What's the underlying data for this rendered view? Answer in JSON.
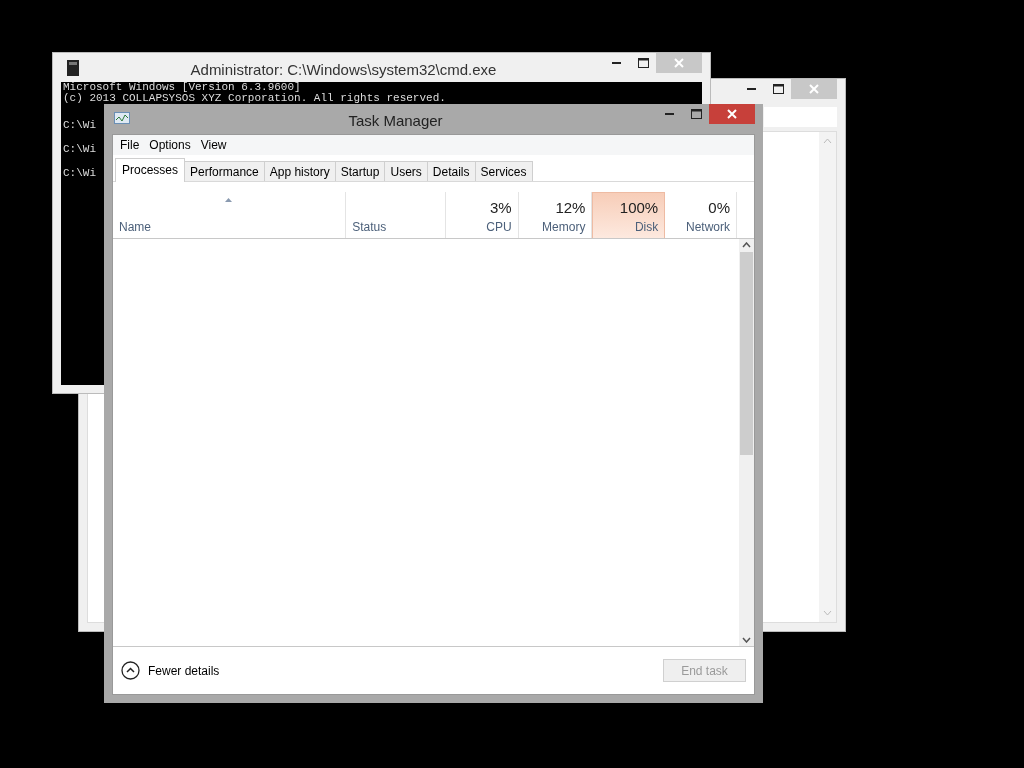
{
  "cmd_window": {
    "title": "Administrator: C:\\Windows\\system32\\cmd.exe",
    "lines": [
      "Microsoft Windows [Version 6.3.9600]",
      "(c) 2013 COLLAPSYSOS XYZ Corporation. All rights reserved.",
      "C:\\Wi",
      "C:\\Wi",
      "C:\\Wi"
    ]
  },
  "task_manager": {
    "title": "Task Manager",
    "menu": [
      "File",
      "Options",
      "View"
    ],
    "tabs": [
      {
        "label": "Processes",
        "selected": true
      },
      {
        "label": "Performance",
        "selected": false
      },
      {
        "label": "App history",
        "selected": false
      },
      {
        "label": "Startup",
        "selected": false
      },
      {
        "label": "Users",
        "selected": false
      },
      {
        "label": "Details",
        "selected": false
      },
      {
        "label": "Services",
        "selected": false
      }
    ],
    "columns": [
      {
        "heading": "Name",
        "sorted": true,
        "highlighted": false
      },
      {
        "heading": "Status",
        "sorted": false,
        "highlighted": false
      },
      {
        "value": "3%",
        "heading": "CPU",
        "sorted": false,
        "highlighted": false
      },
      {
        "value": "12%",
        "heading": "Memory",
        "sorted": false,
        "highlighted": false
      },
      {
        "value": "100%",
        "heading": "Disk",
        "sorted": false,
        "highlighted": true
      },
      {
        "value": "0%",
        "heading": "Network",
        "sorted": false,
        "highlighted": false
      }
    ],
    "footer": {
      "toggle": "Fewer details",
      "button": {
        "label": "End task",
        "disabled": true
      }
    }
  }
}
